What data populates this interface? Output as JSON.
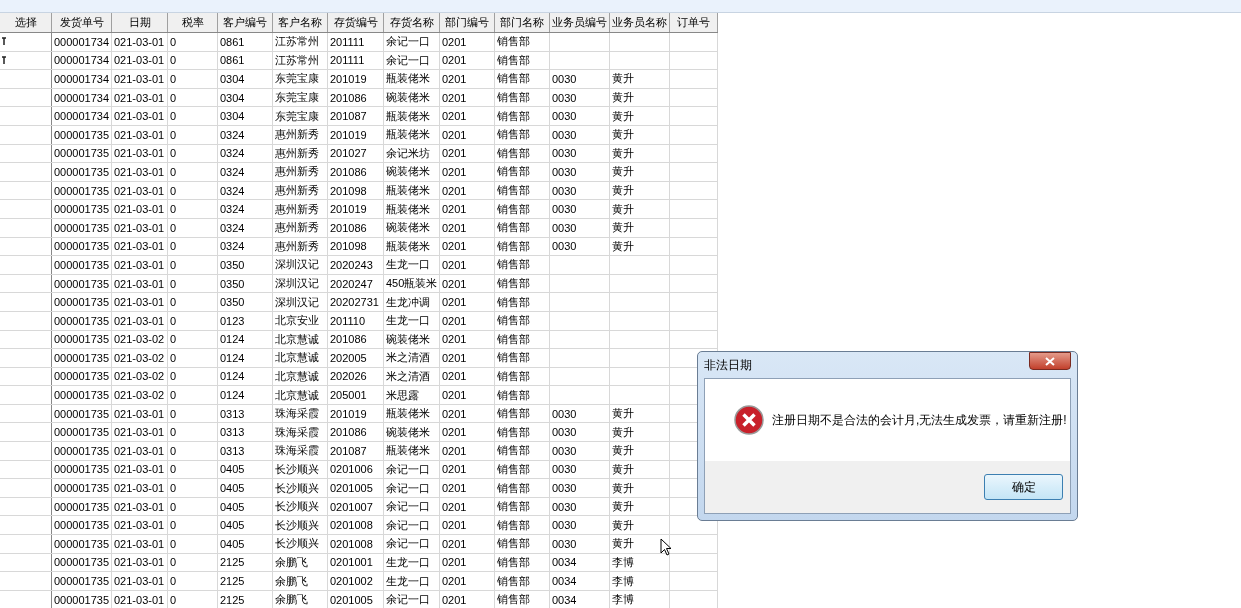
{
  "table": {
    "columns": [
      "选择",
      "发货单号",
      "日期",
      "税率",
      "客户编号",
      "客户名称",
      "存货编号",
      "存货名称",
      "部门编号",
      "部门名称",
      "业务员编号",
      "业务员名称",
      "订单号"
    ],
    "rows": [
      {
        "selected": true,
        "cells": [
          "",
          "000001734",
          "021-03-01",
          "0",
          "0861",
          "江苏常州",
          "201111",
          "余记一口",
          "0201",
          "销售部",
          "",
          "",
          ""
        ]
      },
      {
        "selected": true,
        "cells": [
          "",
          "000001734",
          "021-03-01",
          "0",
          "0861",
          "江苏常州",
          "201111",
          "余记一口",
          "0201",
          "销售部",
          "",
          "",
          ""
        ]
      },
      {
        "selected": false,
        "cells": [
          "",
          "000001734",
          "021-03-01",
          "0",
          "0304",
          "东莞宝康",
          "201019",
          "瓶装佬米",
          "0201",
          "销售部",
          "0030",
          "黄升",
          ""
        ]
      },
      {
        "selected": false,
        "cells": [
          "",
          "000001734",
          "021-03-01",
          "0",
          "0304",
          "东莞宝康",
          "201086",
          "碗装佬米",
          "0201",
          "销售部",
          "0030",
          "黄升",
          ""
        ]
      },
      {
        "selected": false,
        "cells": [
          "",
          "000001734",
          "021-03-01",
          "0",
          "0304",
          "东莞宝康",
          "201087",
          "瓶装佬米",
          "0201",
          "销售部",
          "0030",
          "黄升",
          ""
        ]
      },
      {
        "selected": false,
        "cells": [
          "",
          "000001735",
          "021-03-01",
          "0",
          "0324",
          "惠州新秀",
          "201019",
          "瓶装佬米",
          "0201",
          "销售部",
          "0030",
          "黄升",
          ""
        ]
      },
      {
        "selected": false,
        "cells": [
          "",
          "000001735",
          "021-03-01",
          "0",
          "0324",
          "惠州新秀",
          "201027",
          "余记米坊",
          "0201",
          "销售部",
          "0030",
          "黄升",
          ""
        ]
      },
      {
        "selected": false,
        "cells": [
          "",
          "000001735",
          "021-03-01",
          "0",
          "0324",
          "惠州新秀",
          "201086",
          "碗装佬米",
          "0201",
          "销售部",
          "0030",
          "黄升",
          ""
        ]
      },
      {
        "selected": false,
        "cells": [
          "",
          "000001735",
          "021-03-01",
          "0",
          "0324",
          "惠州新秀",
          "201098",
          "瓶装佬米",
          "0201",
          "销售部",
          "0030",
          "黄升",
          ""
        ]
      },
      {
        "selected": false,
        "cells": [
          "",
          "000001735",
          "021-03-01",
          "0",
          "0324",
          "惠州新秀",
          "201019",
          "瓶装佬米",
          "0201",
          "销售部",
          "0030",
          "黄升",
          ""
        ]
      },
      {
        "selected": false,
        "cells": [
          "",
          "000001735",
          "021-03-01",
          "0",
          "0324",
          "惠州新秀",
          "201086",
          "碗装佬米",
          "0201",
          "销售部",
          "0030",
          "黄升",
          ""
        ]
      },
      {
        "selected": false,
        "cells": [
          "",
          "000001735",
          "021-03-01",
          "0",
          "0324",
          "惠州新秀",
          "201098",
          "瓶装佬米",
          "0201",
          "销售部",
          "0030",
          "黄升",
          ""
        ]
      },
      {
        "selected": false,
        "cells": [
          "",
          "000001735",
          "021-03-01",
          "0",
          "0350",
          "深圳汉记",
          "2020243",
          "生龙一口",
          "0201",
          "销售部",
          "",
          "",
          ""
        ]
      },
      {
        "selected": false,
        "cells": [
          "",
          "000001735",
          "021-03-01",
          "0",
          "0350",
          "深圳汉记",
          "2020247",
          "450瓶装米",
          "0201",
          "销售部",
          "",
          "",
          ""
        ]
      },
      {
        "selected": false,
        "cells": [
          "",
          "000001735",
          "021-03-01",
          "0",
          "0350",
          "深圳汉记",
          "20202731",
          "生龙冲调",
          "0201",
          "销售部",
          "",
          "",
          ""
        ]
      },
      {
        "selected": false,
        "cells": [
          "",
          "000001735",
          "021-03-01",
          "0",
          "0123",
          "北京安业",
          "201110",
          "生龙一口",
          "0201",
          "销售部",
          "",
          "",
          ""
        ]
      },
      {
        "selected": false,
        "cells": [
          "",
          "000001735",
          "021-03-02",
          "0",
          "0124",
          "北京慧诚",
          "201086",
          "碗装佬米",
          "0201",
          "销售部",
          "",
          "",
          ""
        ]
      },
      {
        "selected": false,
        "cells": [
          "",
          "000001735",
          "021-03-02",
          "0",
          "0124",
          "北京慧诚",
          "202005",
          "米之清酒",
          "0201",
          "销售部",
          "",
          "",
          ""
        ]
      },
      {
        "selected": false,
        "cells": [
          "",
          "000001735",
          "021-03-02",
          "0",
          "0124",
          "北京慧诚",
          "202026",
          "米之清酒",
          "0201",
          "销售部",
          "",
          "",
          ""
        ]
      },
      {
        "selected": false,
        "cells": [
          "",
          "000001735",
          "021-03-02",
          "0",
          "0124",
          "北京慧诚",
          "205001",
          "米思露",
          "0201",
          "销售部",
          "",
          "",
          ""
        ]
      },
      {
        "selected": false,
        "cells": [
          "",
          "000001735",
          "021-03-01",
          "0",
          "0313",
          "珠海采霞",
          "201019",
          "瓶装佬米",
          "0201",
          "销售部",
          "0030",
          "黄升",
          ""
        ]
      },
      {
        "selected": false,
        "cells": [
          "",
          "000001735",
          "021-03-01",
          "0",
          "0313",
          "珠海采霞",
          "201086",
          "碗装佬米",
          "0201",
          "销售部",
          "0030",
          "黄升",
          ""
        ]
      },
      {
        "selected": false,
        "cells": [
          "",
          "000001735",
          "021-03-01",
          "0",
          "0313",
          "珠海采霞",
          "201087",
          "瓶装佬米",
          "0201",
          "销售部",
          "0030",
          "黄升",
          ""
        ]
      },
      {
        "selected": false,
        "cells": [
          "",
          "000001735",
          "021-03-01",
          "0",
          "0405",
          "长沙顺兴",
          "0201006",
          "余记一口",
          "0201",
          "销售部",
          "0030",
          "黄升",
          ""
        ]
      },
      {
        "selected": false,
        "cells": [
          "",
          "000001735",
          "021-03-01",
          "0",
          "0405",
          "长沙顺兴",
          "0201005",
          "余记一口",
          "0201",
          "销售部",
          "0030",
          "黄升",
          ""
        ]
      },
      {
        "selected": false,
        "cells": [
          "",
          "000001735",
          "021-03-01",
          "0",
          "0405",
          "长沙顺兴",
          "0201007",
          "余记一口",
          "0201",
          "销售部",
          "0030",
          "黄升",
          ""
        ]
      },
      {
        "selected": false,
        "cells": [
          "",
          "000001735",
          "021-03-01",
          "0",
          "0405",
          "长沙顺兴",
          "0201008",
          "余记一口",
          "0201",
          "销售部",
          "0030",
          "黄升",
          ""
        ]
      },
      {
        "selected": false,
        "cells": [
          "",
          "000001735",
          "021-03-01",
          "0",
          "0405",
          "长沙顺兴",
          "0201008",
          "余记一口",
          "0201",
          "销售部",
          "0030",
          "黄升",
          ""
        ]
      },
      {
        "selected": false,
        "cells": [
          "",
          "000001735",
          "021-03-01",
          "0",
          "2125",
          "余鹏飞",
          "0201001",
          "生龙一口",
          "0201",
          "销售部",
          "0034",
          "李博",
          ""
        ]
      },
      {
        "selected": false,
        "cells": [
          "",
          "000001735",
          "021-03-01",
          "0",
          "2125",
          "余鹏飞",
          "0201002",
          "生龙一口",
          "0201",
          "销售部",
          "0034",
          "李博",
          ""
        ]
      },
      {
        "selected": false,
        "cells": [
          "",
          "000001735",
          "021-03-01",
          "0",
          "2125",
          "余鹏飞",
          "0201005",
          "余记一口",
          "0201",
          "销售部",
          "0034",
          "李博",
          ""
        ]
      }
    ]
  },
  "dialog": {
    "title": "非法日期",
    "message": "注册日期不是合法的会计月,无法生成发票，请重新注册!",
    "button": "确定"
  }
}
